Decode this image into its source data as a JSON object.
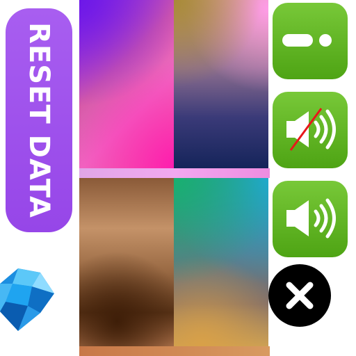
{
  "reset_button": {
    "label": "RESET DATA"
  },
  "palette": {
    "swatches": [
      {
        "id": "swatch-1",
        "colors": [
          "#6d18e8",
          "#f06ac2",
          "#ff1ab0"
        ]
      },
      {
        "id": "swatch-2",
        "colors": [
          "#a88a38",
          "#ff9ce8",
          "#15245a"
        ]
      },
      {
        "id": "swatch-3",
        "colors": [
          "#c49268",
          "#3e1e08",
          "#b0744c"
        ]
      },
      {
        "id": "swatch-4",
        "colors": [
          "#18b070",
          "#20a8d8",
          "#c8a058"
        ]
      }
    ]
  },
  "controls": {
    "slider_icon": "slider-toggle-icon",
    "mute_icon": "speaker-muted-icon",
    "sound_icon": "speaker-on-icon",
    "close_icon": "close-icon",
    "button_color": "#5fb421",
    "mute_slash_color": "#e8161a"
  },
  "logo": {
    "icon": "blue-gem-icon",
    "color": "#1fa4f0"
  }
}
